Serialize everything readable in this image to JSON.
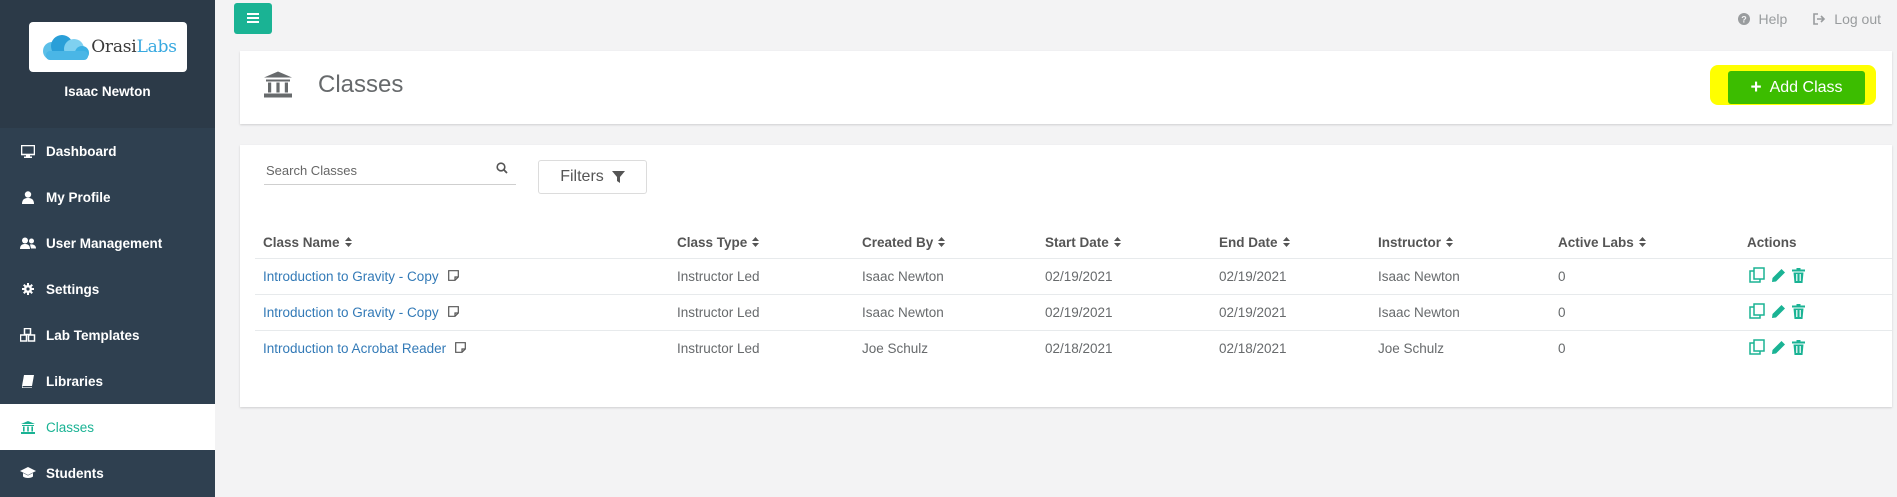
{
  "brand": {
    "name_part1": "Orasi",
    "name_part2": "Labs",
    "accent": "#1ab394",
    "sidebar_bg": "#2f4050"
  },
  "user": {
    "name": "Isaac Newton"
  },
  "sidebar": {
    "items": [
      {
        "label": "Dashboard",
        "icon": "desktop-icon",
        "active": false
      },
      {
        "label": "My Profile",
        "icon": "user-icon",
        "active": false
      },
      {
        "label": "User Management",
        "icon": "users-icon",
        "active": false
      },
      {
        "label": "Settings",
        "icon": "gear-icon",
        "active": false
      },
      {
        "label": "Lab Templates",
        "icon": "cubes-icon",
        "active": false
      },
      {
        "label": "Libraries",
        "icon": "book-icon",
        "active": false
      },
      {
        "label": "Classes",
        "icon": "institution-icon",
        "active": true
      },
      {
        "label": "Students",
        "icon": "graduation-cap-icon",
        "active": false
      }
    ]
  },
  "topbar": {
    "help_label": "Help",
    "logout_label": "Log out"
  },
  "header": {
    "title": "Classes",
    "add_button_label": "Add Class",
    "highlight_color": "#ffff00",
    "add_button_color": "#3cbd00"
  },
  "search": {
    "placeholder": "Search Classes",
    "value": ""
  },
  "filters": {
    "label": "Filters"
  },
  "table": {
    "columns": [
      "Class Name",
      "Class Type",
      "Created By",
      "Start Date",
      "End Date",
      "Instructor",
      "Active Labs",
      "Actions"
    ],
    "rows": [
      {
        "class_name": "Introduction to Gravity - Copy",
        "class_type": "Instructor Led",
        "created_by": "Isaac Newton",
        "start_date": "02/19/2021",
        "end_date": "02/19/2021",
        "instructor": "Isaac Newton",
        "active_labs": "0"
      },
      {
        "class_name": "Introduction to Gravity - Copy",
        "class_type": "Instructor Led",
        "created_by": "Isaac Newton",
        "start_date": "02/19/2021",
        "end_date": "02/19/2021",
        "instructor": "Isaac Newton",
        "active_labs": "0"
      },
      {
        "class_name": "Introduction to Acrobat Reader",
        "class_type": "Instructor Led",
        "created_by": "Joe Schulz",
        "start_date": "02/18/2021",
        "end_date": "02/18/2021",
        "instructor": "Joe Schulz",
        "active_labs": "0"
      }
    ],
    "action_icons": [
      "copy-icon",
      "edit-icon",
      "delete-icon"
    ]
  }
}
